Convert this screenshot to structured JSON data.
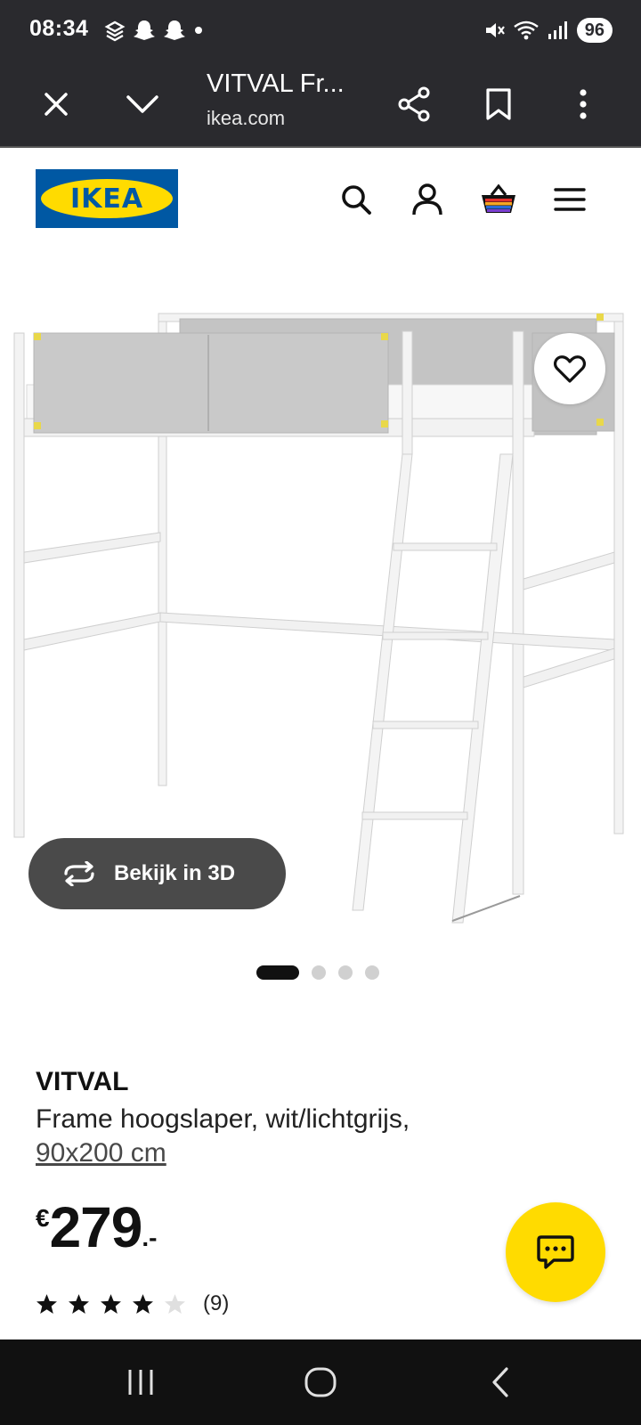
{
  "status_bar": {
    "time": "08:34",
    "battery": "96",
    "left_icons": [
      "stack-icon",
      "snapchat-icon",
      "snapchat-icon",
      "dot-icon"
    ],
    "right_icons": [
      "mute-vibrate-icon",
      "wifi-icon",
      "signal-icon"
    ]
  },
  "browser": {
    "page_title": "VITVAL Fr...",
    "url": "ikea.com",
    "buttons": [
      "close-icon",
      "chevron-down-icon",
      "share-icon",
      "bookmark-icon",
      "more-vert-icon"
    ]
  },
  "header": {
    "logo_text": "IKEA",
    "brand_colors": {
      "blue": "#0058a3",
      "yellow": "#ffdb00"
    },
    "icons": [
      "search-icon",
      "account-icon",
      "basket-icon",
      "menu-icon"
    ]
  },
  "gallery": {
    "view_3d_label": "Bekijk in 3D",
    "dots_total": 4,
    "dots_active": 1
  },
  "product": {
    "name": "VITVAL",
    "description": "Frame hoogslaper, wit/lichtgrijs,",
    "size": "90x200 cm",
    "price_currency": "€",
    "price_amount": "279",
    "price_decimals": ".-",
    "rating": 4,
    "rating_max": 5,
    "review_count": "(9)"
  },
  "nav": {
    "buttons": [
      "recent-apps-icon",
      "home-icon",
      "back-icon"
    ]
  }
}
